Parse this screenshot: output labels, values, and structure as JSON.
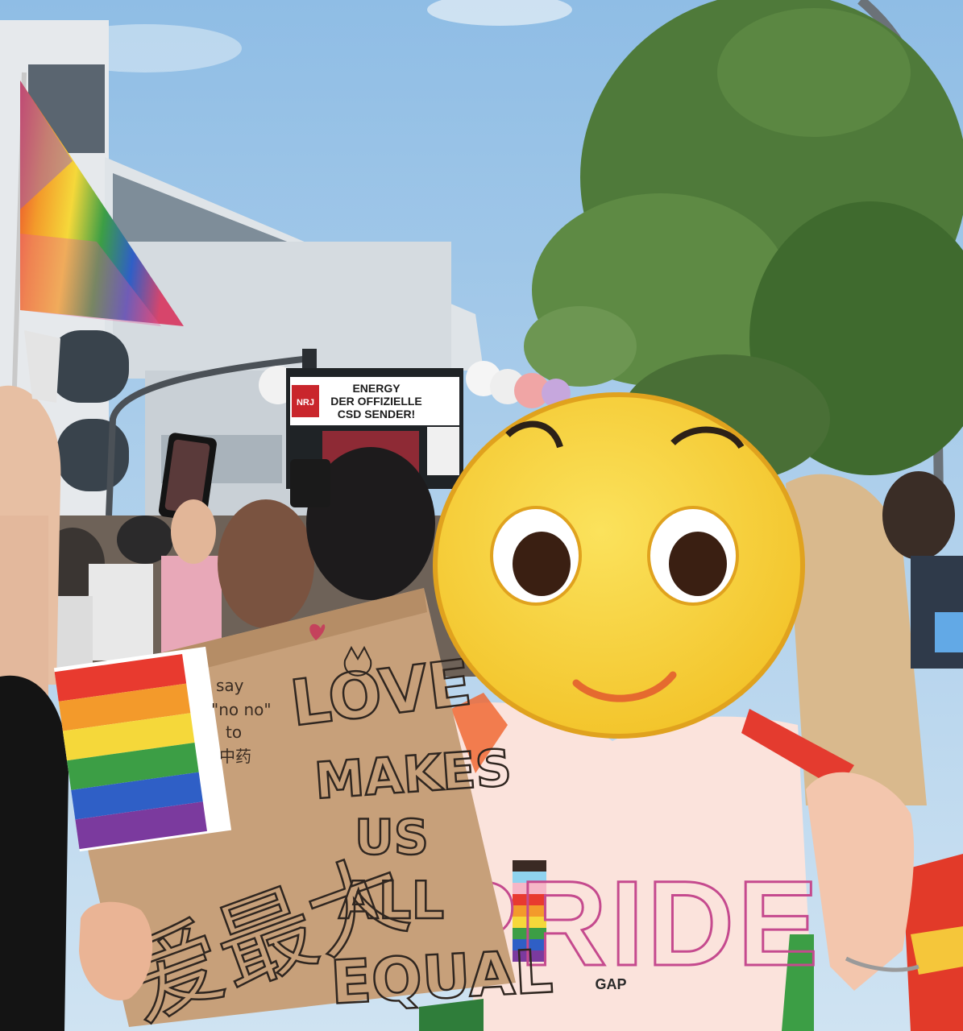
{
  "truck_banner": {
    "line1": "ENERGY",
    "line2": "DER OFFIZIELLE",
    "line3": "CSD SENDER!",
    "logo_text": "NRJ"
  },
  "sign": {
    "side_note_line1": "say",
    "side_note_line2": "\"no no\"",
    "side_note_line3": "to",
    "side_note_line4": "中药",
    "line1": "LOVE",
    "line2": "MAKES",
    "line3": "US",
    "line4": "ALL",
    "line5": "EQUAL",
    "chinese": "爱最大"
  },
  "shirt": {
    "word": "PRIDE",
    "brand": "GAP"
  },
  "colors": {
    "rainbow": [
      "#e83a2f",
      "#f39a2b",
      "#f5d83a",
      "#3c9e45",
      "#2f5fc6",
      "#7b3a9e"
    ],
    "sky": "#9cc6e8",
    "tree": "#4f7a3a",
    "cardboard": "#c9a27a",
    "emoji": "#f7d23c",
    "shirt": "#fbe3dc"
  }
}
